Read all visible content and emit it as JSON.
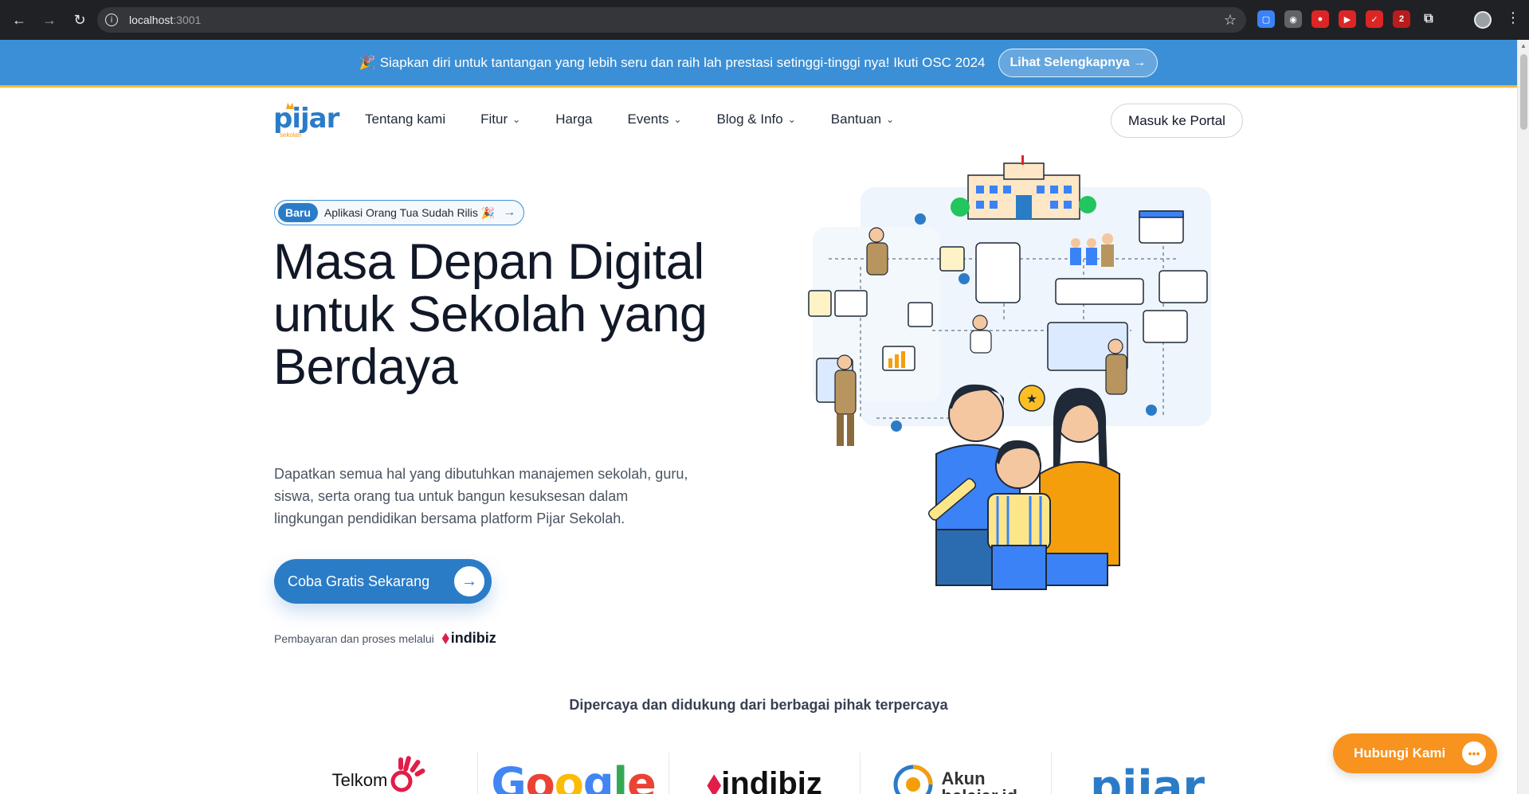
{
  "browser": {
    "url_host": "localhost",
    "url_port": ":3001"
  },
  "banner": {
    "emoji": "🎉",
    "text": "Siapkan diri untuk tantangan yang lebih seru dan raih lah prestasi setinggi-tinggi nya! Ikuti OSC 2024",
    "button_label": "Lihat Selengkapnya →"
  },
  "header": {
    "logo_text": "pijar",
    "logo_sub": "sekolah",
    "nav": [
      {
        "label": "Tentang kami",
        "dropdown": false
      },
      {
        "label": "Fitur",
        "dropdown": true
      },
      {
        "label": "Harga",
        "dropdown": false
      },
      {
        "label": "Events",
        "dropdown": true
      },
      {
        "label": "Blog & Info",
        "dropdown": true
      },
      {
        "label": "Bantuan",
        "dropdown": true
      }
    ],
    "portal_button": "Masuk ke Portal"
  },
  "hero": {
    "badge_pill": "Baru",
    "badge_text": "Aplikasi Orang Tua Sudah Rilis 🎉",
    "title": "Masa Depan Digital untuk Sekolah yang Berdaya",
    "description": "Dapatkan semua hal yang dibutuhkan manajemen sekolah, guru, siswa, serta orang tua untuk bangun kesuksesan dalam lingkungan pendidikan bersama platform Pijar Sekolah.",
    "cta_label": "Coba Gratis Sekarang",
    "payment_note": "Pembayaran dan proses melalui",
    "payment_brand": "indibiz"
  },
  "trusted": {
    "title": "Dipercaya dan didukung dari berbagai pihak terpercaya",
    "partners": [
      "Telkom",
      "Google",
      "indibiz",
      "Akun belajar.id",
      "pijar"
    ]
  },
  "contact": {
    "label": "Hubungi Kami"
  },
  "colors": {
    "primary": "#2b7cc7",
    "banner": "#3b8fd6",
    "accent_orange": "#f7931e",
    "banner_underline": "#f5b83d"
  }
}
